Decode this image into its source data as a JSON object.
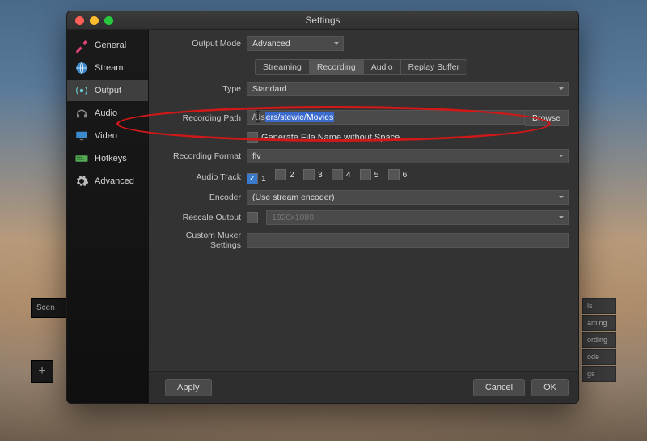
{
  "window": {
    "title": "Settings"
  },
  "sidebar": {
    "items": [
      {
        "label": "General"
      },
      {
        "label": "Stream"
      },
      {
        "label": "Output"
      },
      {
        "label": "Audio"
      },
      {
        "label": "Video"
      },
      {
        "label": "Hotkeys"
      },
      {
        "label": "Advanced"
      }
    ],
    "active_index": 2
  },
  "output_mode": {
    "label": "Output Mode",
    "value": "Advanced"
  },
  "tabs": {
    "items": [
      "Streaming",
      "Recording",
      "Audio",
      "Replay Buffer"
    ],
    "active_index": 1
  },
  "recording": {
    "type_label": "Type",
    "type_value": "Standard",
    "path_label": "Recording Path",
    "path_prefix": "/Us",
    "path_selected": "ers/stewie/Movies",
    "browse_label": "Browse",
    "gen_no_space_label": "Generate File Name without Space",
    "gen_no_space_checked": false,
    "format_label": "Recording Format",
    "format_value": "flv",
    "audio_track_label": "Audio Track",
    "audio_tracks": [
      {
        "n": "1",
        "on": true
      },
      {
        "n": "2",
        "on": false
      },
      {
        "n": "3",
        "on": false
      },
      {
        "n": "4",
        "on": false
      },
      {
        "n": "5",
        "on": false
      },
      {
        "n": "6",
        "on": false
      }
    ],
    "encoder_label": "Encoder",
    "encoder_value": "(Use stream encoder)",
    "rescale_label": "Rescale Output",
    "rescale_checked": false,
    "rescale_value": "1920x1080",
    "muxer_label": "Custom Muxer Settings",
    "muxer_value": ""
  },
  "footer": {
    "apply": "Apply",
    "cancel": "Cancel",
    "ok": "OK"
  },
  "behind": {
    "scenes_label": "Scen",
    "plus": "+",
    "right_items": [
      "ls",
      "aming",
      "ording",
      "ode",
      "gs"
    ]
  },
  "colors": {
    "accent": "#3a7acc",
    "annotation": "#d01818"
  }
}
